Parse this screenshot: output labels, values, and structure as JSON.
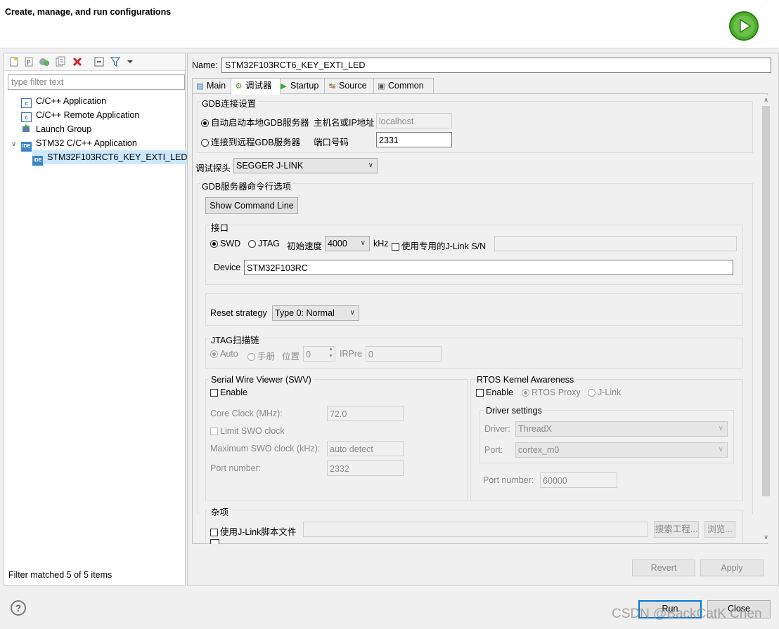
{
  "header": {
    "title": "Create, manage, and run configurations"
  },
  "left": {
    "toolbar_icons": [
      "new-config-icon",
      "new-prototype-icon",
      "duplicate-icon",
      "export-icon",
      "delete-icon",
      "collapse-all-icon",
      "filter-icon",
      "dropdown-menu-icon"
    ],
    "filter_placeholder": "type filter text",
    "tree": [
      {
        "label": "C/C++ Application",
        "icon": "c-app-icon",
        "level": 1
      },
      {
        "label": "C/C++ Remote Application",
        "icon": "c-app-icon",
        "level": 1
      },
      {
        "label": "Launch Group",
        "icon": "launch-group-icon",
        "level": 1
      },
      {
        "label": "STM32 C/C++ Application",
        "icon": "ide-icon",
        "level": 1,
        "expanded": true
      },
      {
        "label": "STM32F103RCT6_KEY_EXTI_LED",
        "icon": "ide-icon",
        "level": 2,
        "selected": true
      }
    ],
    "status": "Filter matched 5 of 5 items"
  },
  "right": {
    "name_label": "Name:",
    "name_value": "STM32F103RCT6_KEY_EXTI_LED",
    "tabs": [
      {
        "label": "Main",
        "icon": "main-tab-icon"
      },
      {
        "label": "调试器",
        "icon": "debugger-tab-icon",
        "active": true
      },
      {
        "label": "Startup",
        "icon": "startup-tab-icon"
      },
      {
        "label": "Source",
        "icon": "source-tab-icon"
      },
      {
        "label": "Common",
        "icon": "common-tab-icon"
      }
    ],
    "gdb_conn": {
      "title": "GDB连接设置",
      "local_label": "自动启动本地GDB服务器",
      "host_label": "主机名或IP地址",
      "host_value": "localhost",
      "remote_label": "连接到远程GDB服务器",
      "port_label": "端口号码",
      "port_value": "2331"
    },
    "probe_label": "调试探头",
    "probe_value": "SEGGER J-LINK",
    "gdb_opts": {
      "title": "GDB服务器命令行选项",
      "show_cmd_button": "Show Command Line",
      "interface_title": "接口",
      "swd_label": "SWD",
      "jtag_label": "JTAG",
      "speed_label": "初始速度",
      "speed_value": "4000",
      "khz_label": "kHz",
      "sn_label": "使用专用的J-Link S/N",
      "device_label": "Device",
      "device_value": "STM32F103RC",
      "reset_label": "Reset strategy",
      "reset_value": "Type 0: Normal",
      "jtag_chain_title": "JTAG扫描链",
      "auto_label": "Auto",
      "manual_label": "手册",
      "position_label": "位置",
      "position_value": "0",
      "irpre_label": "IRPre",
      "irpre_value": "0"
    },
    "swv": {
      "title": "Serial Wire Viewer (SWV)",
      "enable_label": "Enable",
      "core_clock_label": "Core Clock (MHz):",
      "core_clock_value": "72.0",
      "limit_label": "Limit SWO clock",
      "max_clock_label": "Maximum SWO clock (kHz):",
      "max_clock_value": "auto detect",
      "port_label": "Port number:",
      "port_value": "2332"
    },
    "rtos": {
      "title": "RTOS Kernel Awareness",
      "enable_label": "Enable",
      "proxy_label": "RTOS Proxy",
      "jlink_label": "J-Link",
      "driver_settings_title": "Driver settings",
      "driver_label": "Driver:",
      "driver_value": "ThreadX",
      "port_label": "Port:",
      "port_value": "cortex_m0",
      "port_number_label": "Port number:",
      "port_number_value": "60000"
    },
    "misc": {
      "title": "杂项",
      "script_label": "使用J-Link脚本文件",
      "search_button": "搜索工程...",
      "browse_button": "浏览..."
    },
    "revert_button": "Revert",
    "apply_button": "Apply"
  },
  "footer": {
    "run_button": "Run",
    "close_button": "Close",
    "watermark": "CSDN @BackCatK Chen"
  }
}
